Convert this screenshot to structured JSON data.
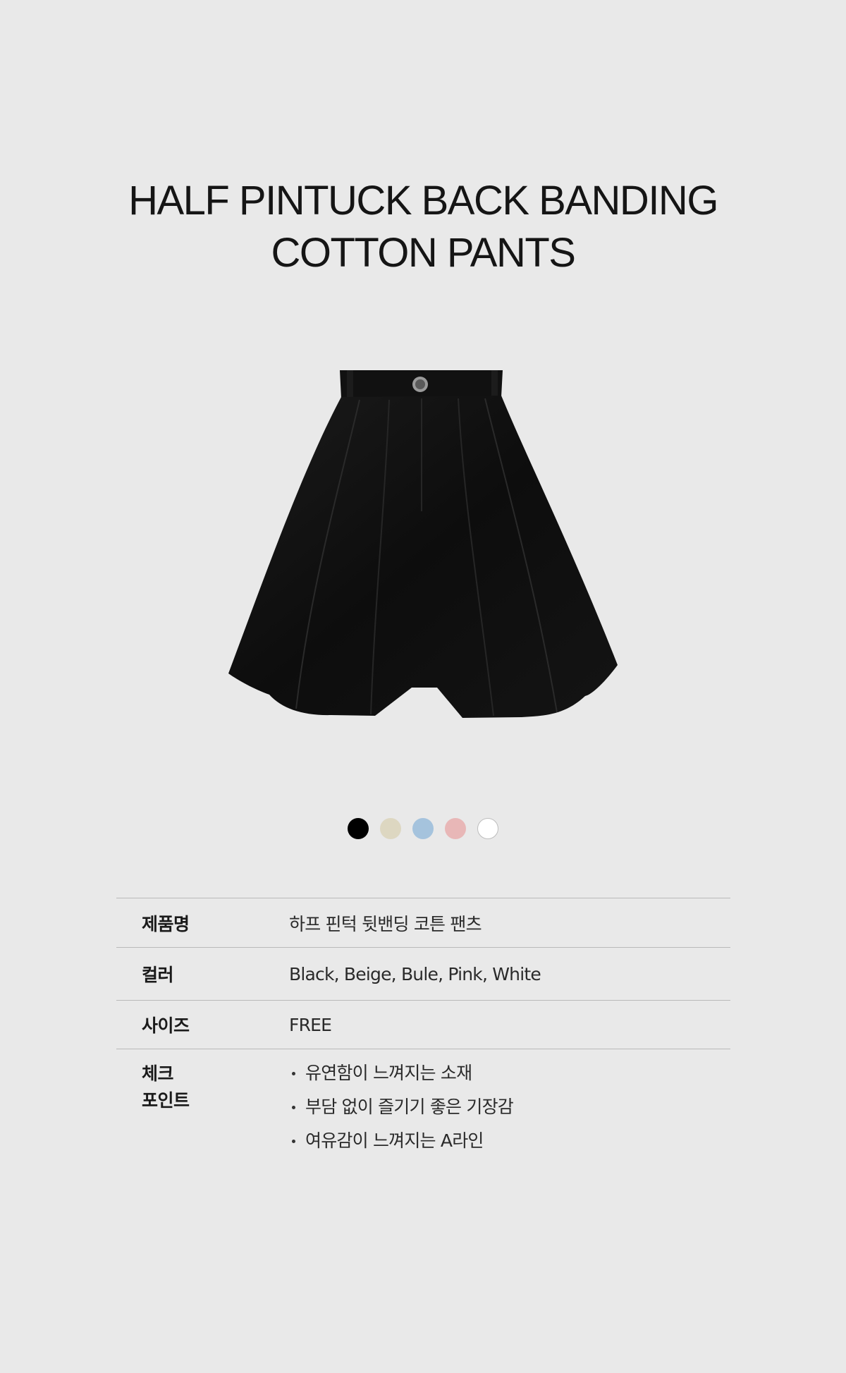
{
  "product": {
    "title_line1": "HALF PINTUCK BACK BANDING",
    "title_line2": "COTTON PANTS"
  },
  "image": {
    "icon": "black-pleated-shorts-illustration"
  },
  "swatches": [
    {
      "name": "black",
      "color": "#000000"
    },
    {
      "name": "beige",
      "color": "#ddd7c1"
    },
    {
      "name": "blue",
      "color": "#a5c3dd"
    },
    {
      "name": "pink",
      "color": "#e8b7b7"
    },
    {
      "name": "white",
      "color": "#ffffff"
    }
  ],
  "specs": {
    "name_label": "제품명",
    "name_value": "하프 핀턱 뒷밴딩 코튼 팬츠",
    "color_label": "컬러",
    "color_value": "Black, Beige, Bule, Pink, White",
    "size_label": "사이즈",
    "size_value": "FREE",
    "check_label": "체크\n포인트",
    "check_points": [
      "유연함이 느껴지는 소재",
      "부담 없이 즐기기 좋은 기장감",
      "여유감이 느껴지는 A라인"
    ]
  }
}
